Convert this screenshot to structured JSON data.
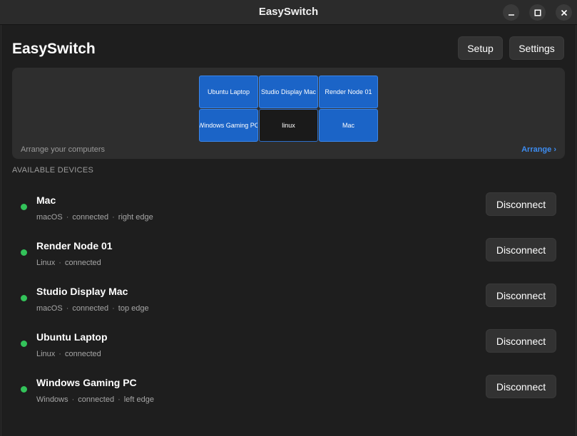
{
  "window": {
    "title": "EasySwitch",
    "controls": {
      "minimize": "minimize-icon",
      "maximize": "maximize-icon",
      "close": "close-icon"
    }
  },
  "header": {
    "title": "EasySwitch",
    "setup_label": "Setup",
    "settings_label": "Settings"
  },
  "arrangement": {
    "tiles": [
      {
        "label": "Ubuntu Laptop",
        "current": false
      },
      {
        "label": "Studio Display Mac",
        "current": false
      },
      {
        "label": "Render Node 01",
        "current": false
      },
      {
        "label": "Windows Gaming PC",
        "current": false
      },
      {
        "label": "linux",
        "current": true
      },
      {
        "label": "Mac",
        "current": false
      }
    ],
    "hint": "Arrange your computers",
    "link_label": "Arrange ›"
  },
  "devices": {
    "heading": "AVAILABLE DEVICES",
    "items": [
      {
        "name": "Mac",
        "os": "macOS",
        "status": "connected",
        "edge": "right edge",
        "action": "Disconnect"
      },
      {
        "name": "Render Node 01",
        "os": "Linux",
        "status": "connected",
        "edge": "",
        "action": "Disconnect"
      },
      {
        "name": "Studio Display Mac",
        "os": "macOS",
        "status": "connected",
        "edge": "top edge",
        "action": "Disconnect"
      },
      {
        "name": "Ubuntu Laptop",
        "os": "Linux",
        "status": "connected",
        "edge": "",
        "action": "Disconnect"
      },
      {
        "name": "Windows Gaming PC",
        "os": "Windows",
        "status": "connected",
        "edge": "left edge",
        "action": "Disconnect"
      }
    ]
  },
  "colors": {
    "accent": "#1b64c7",
    "link": "#3d8cf0",
    "status_connected": "#33c35a",
    "background": "#1e1e1e",
    "panel": "#2e2e2e"
  }
}
